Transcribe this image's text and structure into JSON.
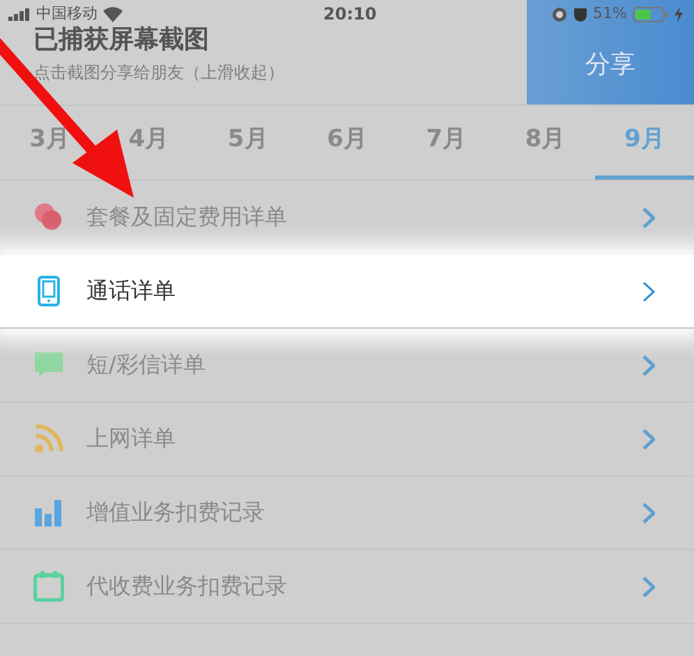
{
  "status_bar": {
    "carrier": "中国移动",
    "time": "20:10",
    "battery_text": "51%"
  },
  "notification": {
    "title": "已捕获屏幕截图",
    "subtitle": "点击截图分享给朋友（上滑收起）",
    "action": "分享"
  },
  "months": [
    {
      "label": "3月",
      "selected": false
    },
    {
      "label": "4月",
      "selected": false
    },
    {
      "label": "5月",
      "selected": false
    },
    {
      "label": "6月",
      "selected": false
    },
    {
      "label": "7月",
      "selected": false
    },
    {
      "label": "8月",
      "selected": false
    },
    {
      "label": "9月",
      "selected": true
    }
  ],
  "items": [
    {
      "kind": "package",
      "label": "套餐及固定费用详单",
      "highlighted": false
    },
    {
      "kind": "call",
      "label": "通话详单",
      "highlighted": true
    },
    {
      "kind": "message",
      "label": "短/彩信详单",
      "highlighted": false
    },
    {
      "kind": "data",
      "label": "上网详单",
      "highlighted": false
    },
    {
      "kind": "value",
      "label": "增值业务扣费记录",
      "highlighted": false
    },
    {
      "kind": "collect",
      "label": "代收费业务扣费记录",
      "highlighted": false
    }
  ]
}
